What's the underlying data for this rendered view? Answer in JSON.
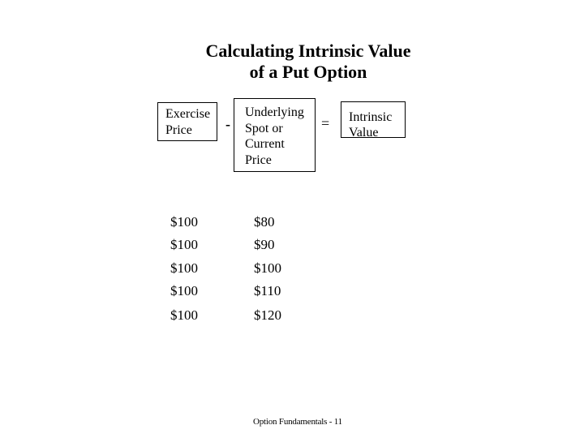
{
  "slide": {
    "title_line1": "Calculating Intrinsic Value",
    "title_line2": "of a Put Option"
  },
  "formula": {
    "exercise_price": [
      "Exercise",
      "Price"
    ],
    "minus_operator": "-",
    "underlying_price": [
      "Underlying",
      "Spot or",
      "Current",
      "Price"
    ],
    "equals_operator": "=",
    "intrinsic_value": [
      "Intrinsic",
      "Value"
    ]
  },
  "table": {
    "rows": [
      {
        "exercise": "$100",
        "underlying": "$80",
        "intrinsic": ""
      },
      {
        "exercise": "$100",
        "underlying": "$90",
        "intrinsic": ""
      },
      {
        "exercise": "$100",
        "underlying": "$100",
        "intrinsic": ""
      },
      {
        "exercise": "$100",
        "underlying": "$110",
        "intrinsic": ""
      },
      {
        "exercise": "$100",
        "underlying": "$120",
        "intrinsic": ""
      }
    ]
  },
  "footer": {
    "text": "Option Fundamentals - 11"
  }
}
